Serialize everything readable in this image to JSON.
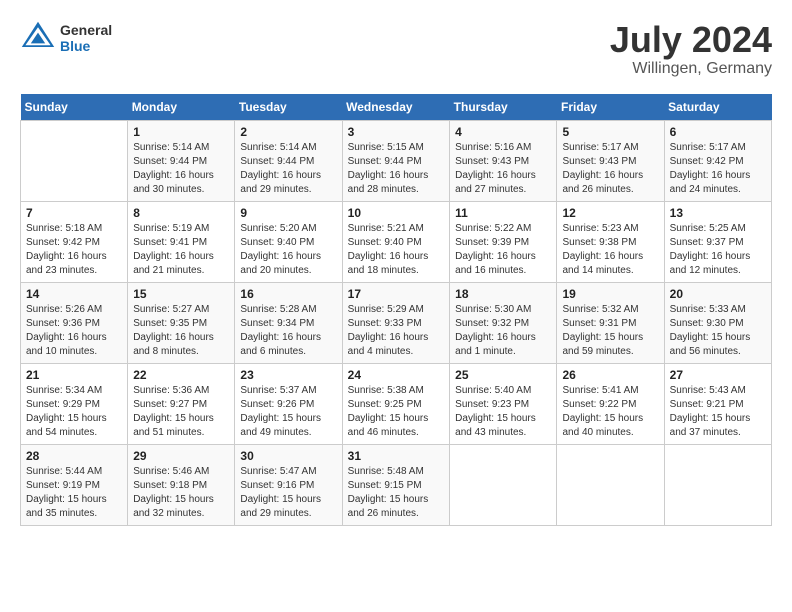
{
  "header": {
    "logo_general": "General",
    "logo_blue": "Blue",
    "month_year": "July 2024",
    "location": "Willingen, Germany"
  },
  "weekdays": [
    "Sunday",
    "Monday",
    "Tuesday",
    "Wednesday",
    "Thursday",
    "Friday",
    "Saturday"
  ],
  "weeks": [
    [
      {
        "num": "",
        "info": ""
      },
      {
        "num": "1",
        "info": "Sunrise: 5:14 AM\nSunset: 9:44 PM\nDaylight: 16 hours\nand 30 minutes."
      },
      {
        "num": "2",
        "info": "Sunrise: 5:14 AM\nSunset: 9:44 PM\nDaylight: 16 hours\nand 29 minutes."
      },
      {
        "num": "3",
        "info": "Sunrise: 5:15 AM\nSunset: 9:44 PM\nDaylight: 16 hours\nand 28 minutes."
      },
      {
        "num": "4",
        "info": "Sunrise: 5:16 AM\nSunset: 9:43 PM\nDaylight: 16 hours\nand 27 minutes."
      },
      {
        "num": "5",
        "info": "Sunrise: 5:17 AM\nSunset: 9:43 PM\nDaylight: 16 hours\nand 26 minutes."
      },
      {
        "num": "6",
        "info": "Sunrise: 5:17 AM\nSunset: 9:42 PM\nDaylight: 16 hours\nand 24 minutes."
      }
    ],
    [
      {
        "num": "7",
        "info": "Sunrise: 5:18 AM\nSunset: 9:42 PM\nDaylight: 16 hours\nand 23 minutes."
      },
      {
        "num": "8",
        "info": "Sunrise: 5:19 AM\nSunset: 9:41 PM\nDaylight: 16 hours\nand 21 minutes."
      },
      {
        "num": "9",
        "info": "Sunrise: 5:20 AM\nSunset: 9:40 PM\nDaylight: 16 hours\nand 20 minutes."
      },
      {
        "num": "10",
        "info": "Sunrise: 5:21 AM\nSunset: 9:40 PM\nDaylight: 16 hours\nand 18 minutes."
      },
      {
        "num": "11",
        "info": "Sunrise: 5:22 AM\nSunset: 9:39 PM\nDaylight: 16 hours\nand 16 minutes."
      },
      {
        "num": "12",
        "info": "Sunrise: 5:23 AM\nSunset: 9:38 PM\nDaylight: 16 hours\nand 14 minutes."
      },
      {
        "num": "13",
        "info": "Sunrise: 5:25 AM\nSunset: 9:37 PM\nDaylight: 16 hours\nand 12 minutes."
      }
    ],
    [
      {
        "num": "14",
        "info": "Sunrise: 5:26 AM\nSunset: 9:36 PM\nDaylight: 16 hours\nand 10 minutes."
      },
      {
        "num": "15",
        "info": "Sunrise: 5:27 AM\nSunset: 9:35 PM\nDaylight: 16 hours\nand 8 minutes."
      },
      {
        "num": "16",
        "info": "Sunrise: 5:28 AM\nSunset: 9:34 PM\nDaylight: 16 hours\nand 6 minutes."
      },
      {
        "num": "17",
        "info": "Sunrise: 5:29 AM\nSunset: 9:33 PM\nDaylight: 16 hours\nand 4 minutes."
      },
      {
        "num": "18",
        "info": "Sunrise: 5:30 AM\nSunset: 9:32 PM\nDaylight: 16 hours\nand 1 minute."
      },
      {
        "num": "19",
        "info": "Sunrise: 5:32 AM\nSunset: 9:31 PM\nDaylight: 15 hours\nand 59 minutes."
      },
      {
        "num": "20",
        "info": "Sunrise: 5:33 AM\nSunset: 9:30 PM\nDaylight: 15 hours\nand 56 minutes."
      }
    ],
    [
      {
        "num": "21",
        "info": "Sunrise: 5:34 AM\nSunset: 9:29 PM\nDaylight: 15 hours\nand 54 minutes."
      },
      {
        "num": "22",
        "info": "Sunrise: 5:36 AM\nSunset: 9:27 PM\nDaylight: 15 hours\nand 51 minutes."
      },
      {
        "num": "23",
        "info": "Sunrise: 5:37 AM\nSunset: 9:26 PM\nDaylight: 15 hours\nand 49 minutes."
      },
      {
        "num": "24",
        "info": "Sunrise: 5:38 AM\nSunset: 9:25 PM\nDaylight: 15 hours\nand 46 minutes."
      },
      {
        "num": "25",
        "info": "Sunrise: 5:40 AM\nSunset: 9:23 PM\nDaylight: 15 hours\nand 43 minutes."
      },
      {
        "num": "26",
        "info": "Sunrise: 5:41 AM\nSunset: 9:22 PM\nDaylight: 15 hours\nand 40 minutes."
      },
      {
        "num": "27",
        "info": "Sunrise: 5:43 AM\nSunset: 9:21 PM\nDaylight: 15 hours\nand 37 minutes."
      }
    ],
    [
      {
        "num": "28",
        "info": "Sunrise: 5:44 AM\nSunset: 9:19 PM\nDaylight: 15 hours\nand 35 minutes."
      },
      {
        "num": "29",
        "info": "Sunrise: 5:46 AM\nSunset: 9:18 PM\nDaylight: 15 hours\nand 32 minutes."
      },
      {
        "num": "30",
        "info": "Sunrise: 5:47 AM\nSunset: 9:16 PM\nDaylight: 15 hours\nand 29 minutes."
      },
      {
        "num": "31",
        "info": "Sunrise: 5:48 AM\nSunset: 9:15 PM\nDaylight: 15 hours\nand 26 minutes."
      },
      {
        "num": "",
        "info": ""
      },
      {
        "num": "",
        "info": ""
      },
      {
        "num": "",
        "info": ""
      }
    ]
  ]
}
